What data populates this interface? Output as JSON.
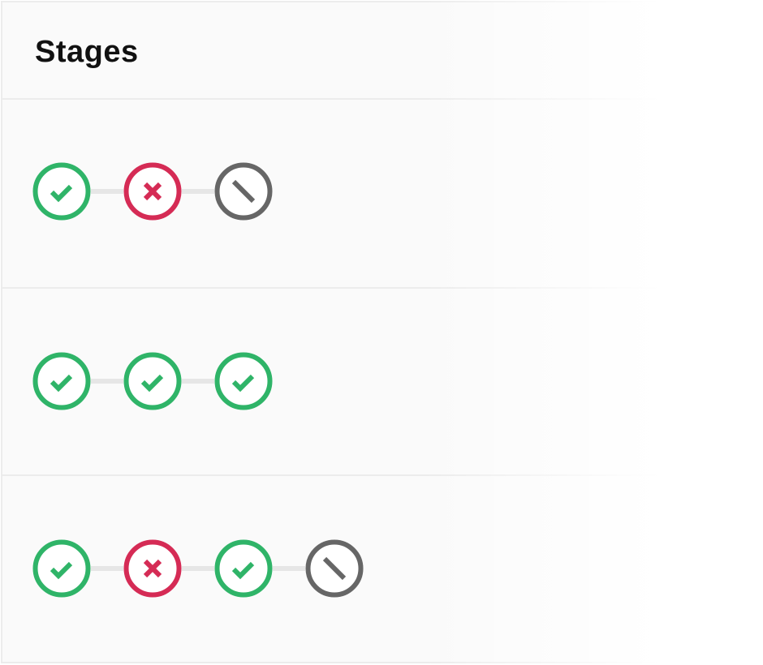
{
  "header": {
    "title": "Stages"
  },
  "colors": {
    "success": "#2fb468",
    "failed": "#d52b55",
    "skipped": "#666666",
    "connector": "#e6e6e6"
  },
  "pipelines": [
    {
      "stages": [
        "success",
        "failed",
        "skipped"
      ]
    },
    {
      "stages": [
        "success",
        "success",
        "success"
      ]
    },
    {
      "stages": [
        "success",
        "failed",
        "success",
        "skipped"
      ]
    }
  ],
  "icons": {
    "success": "check-icon",
    "failed": "x-icon",
    "skipped": "slash-icon"
  }
}
